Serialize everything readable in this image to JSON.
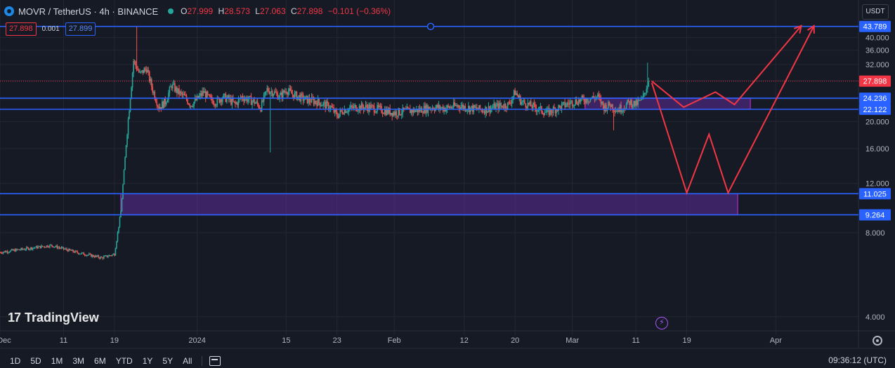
{
  "header": {
    "symbol": "MOVR / TetherUS · 4h · BINANCE",
    "open_label": "O",
    "open": "27.999",
    "high_label": "H",
    "high": "28.573",
    "low_label": "L",
    "low": "27.063",
    "close_label": "C",
    "close": "27.898",
    "change": "−0.101 (−0.36%)"
  },
  "trade": {
    "sell": "27.898",
    "spread": "0.001",
    "buy": "27.899"
  },
  "currency_button": "USDT",
  "watermark": {
    "logo": "17",
    "text": "TradingView"
  },
  "timeframes": [
    "1D",
    "5D",
    "1M",
    "3M",
    "6M",
    "YTD",
    "1Y",
    "5Y",
    "All"
  ],
  "clock": "09:36:12 (UTC)",
  "colors": {
    "background": "#161a25",
    "grid": "#242733",
    "up_candle": "#26a69a",
    "down_candle": "#ef5350",
    "level_line": "#2962ff",
    "zone_fill": "#6a2fb0",
    "zone_border": "#9c27b0",
    "projection": "#f23645",
    "current_price": "#f23645"
  },
  "icons": [
    "coin-logo-icon",
    "market-status-icon",
    "calendar-icon",
    "settings-icon",
    "flash-icon"
  ],
  "chart_data": {
    "type": "candlestick",
    "title": "MOVR / TetherUS · 4h · BINANCE",
    "y_axis": {
      "scale": "log",
      "ylim": [
        3.6,
        52
      ],
      "ticks": [
        "4.000",
        "8.000",
        "12.000",
        "16.000",
        "20.000",
        "24.000",
        "28.000",
        "32.000",
        "36.000",
        "40.000"
      ],
      "tick_values": [
        4,
        8,
        12,
        16,
        20,
        24,
        28,
        32,
        36,
        40
      ]
    },
    "x_axis": {
      "ticks": [
        "Dec",
        "11",
        "19",
        "2024",
        "15",
        "23",
        "Feb",
        "12",
        "20",
        "Mar",
        "11",
        "19",
        "Apr"
      ],
      "tick_days": [
        0,
        10,
        18,
        31,
        45,
        53,
        62,
        73,
        81,
        90,
        100,
        108,
        122
      ],
      "xlim_days": [
        0,
        135
      ]
    },
    "price_series_daily_close": {
      "days": [
        0,
        4,
        8,
        12,
        16,
        18,
        19,
        20,
        21,
        22,
        23,
        24,
        25,
        26,
        27,
        28,
        29,
        30,
        31,
        32,
        33,
        34,
        35,
        36,
        37,
        38,
        39,
        40,
        41,
        42,
        43,
        44,
        45,
        46,
        47,
        48,
        50,
        52,
        53,
        54,
        56,
        58,
        60,
        62,
        64,
        66,
        68,
        70,
        72,
        74,
        76,
        78,
        80,
        81,
        82,
        84,
        86,
        88,
        90,
        92,
        94,
        95,
        96,
        97,
        98,
        99,
        100,
        101,
        102
      ],
      "values": [
        6.8,
        7.0,
        7.2,
        6.8,
        6.5,
        6.7,
        9.5,
        18.5,
        33.0,
        29.5,
        31.0,
        26.0,
        22.5,
        23.5,
        27.0,
        25.5,
        24.5,
        23.0,
        24.0,
        25.5,
        24.0,
        23.5,
        24.5,
        24.0,
        23.0,
        24.5,
        24.0,
        23.5,
        22.5,
        26.0,
        25.5,
        24.5,
        26.0,
        25.0,
        24.5,
        24.0,
        23.5,
        22.5,
        21.0,
        22.0,
        22.5,
        22.5,
        22.0,
        21.5,
        21.8,
        22.0,
        22.5,
        22.3,
        22.8,
        22.3,
        22.0,
        22.6,
        23.0,
        25.5,
        23.5,
        22.5,
        21.5,
        22.5,
        23.5,
        24.0,
        24.5,
        22.5,
        23.0,
        22.0,
        22.5,
        23.5,
        23.0,
        24.0,
        27.898
      ]
    },
    "extremes": {
      "high": 43.789,
      "high_day": 21.5,
      "low": 6.0
    },
    "levels": [
      {
        "name": "resistance-top",
        "value": 43.789,
        "label": "43.789"
      },
      {
        "name": "range-high",
        "value": 24.236,
        "label": "24.236"
      },
      {
        "name": "range-low",
        "value": 22.122,
        "label": "22.122"
      },
      {
        "name": "support-high",
        "value": 11.025,
        "label": "11.025"
      },
      {
        "name": "support-low",
        "value": 9.264,
        "label": "9.264"
      }
    ],
    "current_price": {
      "value": 27.898,
      "label": "27.898"
    },
    "zones": [
      {
        "name": "upper-zone",
        "from_day": 92,
        "to_day": 118,
        "low": 22.122,
        "high": 24.236
      },
      {
        "name": "lower-zone",
        "from_day": 19,
        "to_day": 116,
        "low": 9.264,
        "high": 11.025
      }
    ],
    "projections": [
      {
        "name": "projection-a",
        "points": [
          [
            102.5,
            27.9
          ],
          [
            107.5,
            22.5
          ],
          [
            112.5,
            25.5
          ],
          [
            115.5,
            23
          ],
          [
            126,
            44
          ]
        ]
      },
      {
        "name": "projection-b",
        "points": [
          [
            102.5,
            27.5
          ],
          [
            108,
            11.1
          ],
          [
            111.5,
            18.0
          ],
          [
            114.5,
            11.1
          ],
          [
            128,
            44
          ]
        ]
      }
    ],
    "grid": true,
    "legend": "none"
  }
}
